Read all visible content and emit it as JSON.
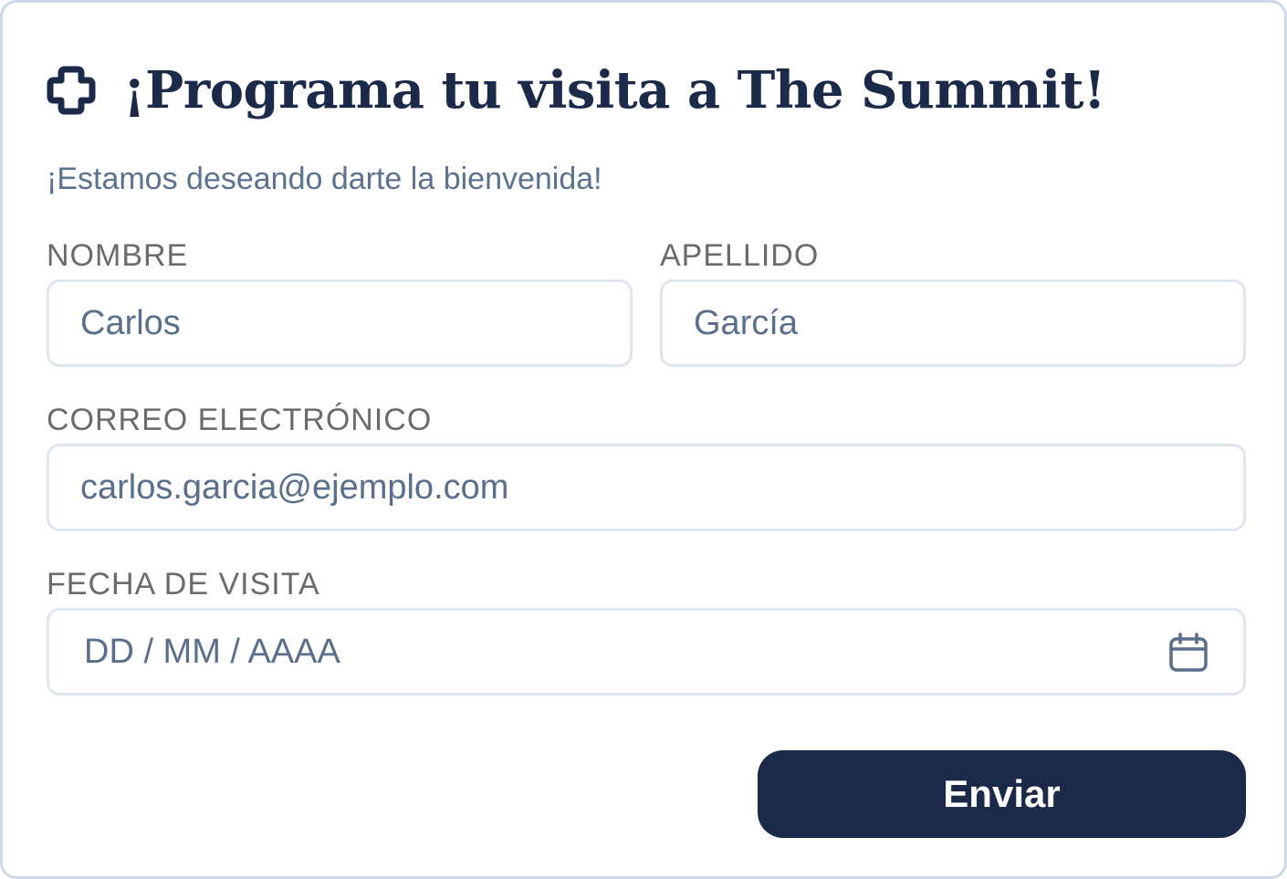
{
  "header": {
    "title": "¡Programa tu visita a The Summit!",
    "icon": "plus-outline-icon",
    "subtitle": "¡Estamos deseando darte la bienvenida!"
  },
  "form": {
    "first_name": {
      "label": "NOMBRE",
      "value": "Carlos"
    },
    "last_name": {
      "label": "APELLIDO",
      "value": "García"
    },
    "email": {
      "label": "CORREO ELECTRÓNICO",
      "value": "carlos.garcia@ejemplo.com"
    },
    "visit_date": {
      "label": "FECHA DE VISITA",
      "placeholder": "DD / MM / AAAA",
      "icon": "calendar-icon"
    },
    "submit_label": "Enviar"
  },
  "colors": {
    "primary": "#1c2a4a",
    "subtitle": "#5b7390",
    "field_text": "#5a6f8b",
    "field_border": "#e0e6ee",
    "card_border": "#cdd9e8"
  }
}
